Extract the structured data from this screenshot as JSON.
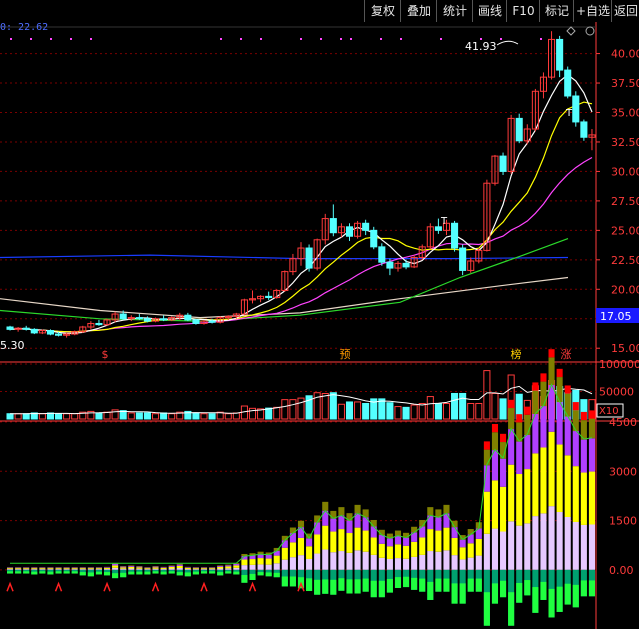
{
  "toolbar": {
    "buttons": [
      "复权",
      "叠加",
      "统计",
      "画线",
      "F10",
      "标记",
      "+自选",
      "返回"
    ]
  },
  "ma_readout": "0: 22.62",
  "price_panel": {
    "y_ticks": [
      "40.00",
      "37.50",
      "35.00",
      "32.50",
      "30.00",
      "27.50",
      "25.00",
      "22.50",
      "20.00",
      "17.50",
      "15.00"
    ],
    "high_label": "41.93",
    "current_price_tag": "17.05",
    "left_low_label": "5.30",
    "t_marks": [
      "T",
      "T"
    ],
    "event_marks": [
      "$",
      "预",
      "榜",
      "涨"
    ]
  },
  "volume_panel": {
    "y_ticks": [
      "100000",
      "50000"
    ],
    "unit_label": "X10"
  },
  "indicator_panel": {
    "y_ticks": [
      "4500",
      "3000",
      "1500",
      "0.00"
    ]
  },
  "colors": {
    "up": "#ff3b3b",
    "down": "#54ffff",
    "ma5": "#ffffff",
    "ma10": "#ffff00",
    "ma20": "#ff44ff",
    "ma60": "#2bd92b",
    "ma120": "#1a3cff",
    "ma250": "#e8d8c8",
    "grid": "#7a0000"
  },
  "chart_data": {
    "type": "candlestick",
    "price_axis": {
      "min": 14,
      "max": 42,
      "ticks": [
        40,
        37.5,
        35,
        32.5,
        30,
        27.5,
        25,
        22.5,
        20,
        17.5,
        15
      ]
    },
    "candles": [
      [
        16.8,
        16.9,
        16.5,
        16.6
      ],
      [
        16.6,
        16.8,
        16.4,
        16.7
      ],
      [
        16.7,
        16.9,
        16.5,
        16.6
      ],
      [
        16.6,
        16.7,
        16.2,
        16.3
      ],
      [
        16.3,
        16.6,
        16.2,
        16.5
      ],
      [
        16.5,
        16.6,
        16.1,
        16.2
      ],
      [
        16.2,
        16.4,
        16.0,
        16.1
      ],
      [
        16.1,
        16.3,
        15.9,
        16.2
      ],
      [
        16.2,
        16.5,
        16.1,
        16.4
      ],
      [
        16.4,
        16.9,
        16.3,
        16.8
      ],
      [
        16.8,
        17.3,
        16.6,
        17.1
      ],
      [
        17.1,
        17.4,
        16.9,
        17.0
      ],
      [
        17.0,
        17.5,
        16.9,
        17.4
      ],
      [
        17.4,
        18.1,
        17.2,
        17.9
      ],
      [
        17.9,
        18.2,
        17.4,
        17.5
      ],
      [
        17.5,
        17.8,
        17.3,
        17.6
      ],
      [
        17.6,
        17.9,
        17.4,
        17.5
      ],
      [
        17.5,
        17.7,
        17.2,
        17.3
      ],
      [
        17.3,
        17.6,
        17.2,
        17.5
      ],
      [
        17.5,
        17.8,
        17.3,
        17.4
      ],
      [
        17.4,
        17.7,
        17.3,
        17.6
      ],
      [
        17.6,
        18.0,
        17.4,
        17.8
      ],
      [
        17.8,
        18.0,
        17.3,
        17.4
      ],
      [
        17.4,
        17.5,
        17.0,
        17.1
      ],
      [
        17.1,
        17.4,
        17.0,
        17.3
      ],
      [
        17.3,
        17.5,
        17.1,
        17.2
      ],
      [
        17.2,
        17.7,
        17.1,
        17.6
      ],
      [
        17.6,
        17.8,
        17.4,
        17.7
      ],
      [
        17.7,
        18.0,
        17.5,
        17.9
      ],
      [
        17.9,
        19.2,
        17.8,
        19.1
      ],
      [
        19.1,
        19.9,
        18.8,
        19.2
      ],
      [
        19.2,
        19.5,
        18.9,
        19.4
      ],
      [
        19.4,
        19.8,
        19.1,
        19.3
      ],
      [
        19.3,
        20.0,
        19.2,
        19.9
      ],
      [
        19.9,
        21.6,
        19.8,
        21.5
      ],
      [
        21.5,
        23.0,
        21.2,
        22.6
      ],
      [
        22.6,
        24.0,
        22.0,
        23.5
      ],
      [
        23.5,
        23.8,
        21.5,
        21.8
      ],
      [
        21.8,
        24.3,
        21.6,
        24.2
      ],
      [
        24.2,
        26.4,
        23.8,
        26.0
      ],
      [
        26.0,
        27.2,
        24.5,
        24.8
      ],
      [
        24.8,
        25.6,
        24.4,
        25.3
      ],
      [
        25.3,
        25.6,
        24.1,
        24.5
      ],
      [
        24.5,
        25.8,
        24.3,
        25.6
      ],
      [
        25.6,
        25.9,
        24.6,
        25.0
      ],
      [
        25.0,
        25.3,
        23.4,
        23.6
      ],
      [
        23.6,
        23.9,
        22.0,
        22.3
      ],
      [
        22.3,
        22.6,
        21.2,
        21.8
      ],
      [
        21.8,
        22.4,
        21.5,
        22.2
      ],
      [
        22.2,
        22.5,
        21.7,
        21.9
      ],
      [
        21.9,
        22.9,
        21.8,
        22.7
      ],
      [
        22.7,
        23.8,
        22.5,
        23.6
      ],
      [
        23.6,
        25.6,
        23.4,
        25.3
      ],
      [
        25.3,
        26.0,
        24.7,
        25.0
      ],
      [
        25.0,
        25.9,
        24.6,
        25.6
      ],
      [
        25.6,
        25.8,
        23.2,
        23.5
      ],
      [
        23.5,
        23.8,
        21.2,
        21.6
      ],
      [
        21.6,
        22.7,
        21.4,
        22.4
      ],
      [
        22.4,
        23.5,
        22.2,
        23.3
      ],
      [
        23.3,
        29.3,
        23.2,
        29.0
      ],
      [
        29.0,
        31.4,
        28.8,
        31.3
      ],
      [
        31.3,
        31.6,
        29.7,
        30.0
      ],
      [
        30.0,
        34.8,
        29.8,
        34.5
      ],
      [
        34.5,
        34.9,
        32.4,
        32.6
      ],
      [
        32.6,
        34.0,
        32.3,
        33.6
      ],
      [
        33.6,
        37.0,
        33.4,
        36.8
      ],
      [
        36.8,
        38.4,
        36.2,
        38.0
      ],
      [
        38.0,
        41.9,
        37.8,
        41.2
      ],
      [
        41.2,
        41.5,
        38.0,
        38.6
      ],
      [
        38.6,
        38.9,
        36.2,
        36.4
      ],
      [
        36.4,
        36.8,
        33.8,
        34.2
      ],
      [
        34.2,
        34.4,
        32.6,
        32.9
      ],
      [
        32.9,
        33.6,
        31.8,
        33.1
      ]
    ],
    "volume_axis": {
      "max": 100000,
      "ticks": [
        100000,
        50000
      ]
    },
    "indicator_axis": {
      "min": -1800,
      "max": 4500,
      "ticks": [
        4500,
        3000,
        1500,
        0
      ]
    }
  }
}
